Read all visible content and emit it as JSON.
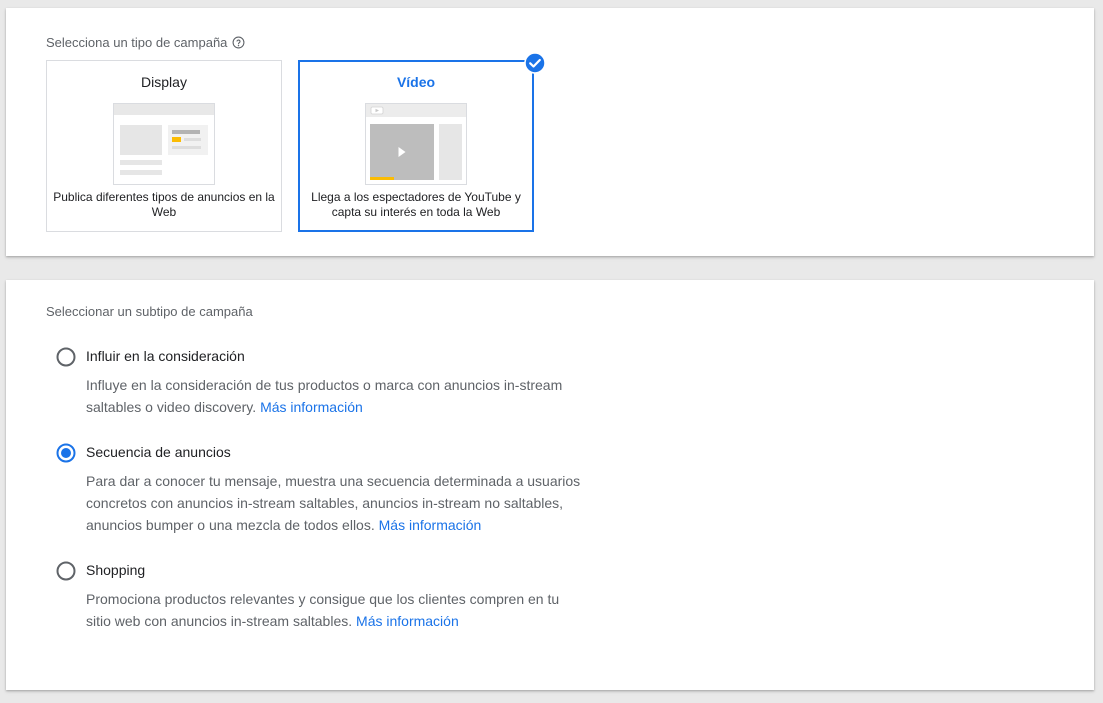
{
  "campaign_type": {
    "label": "Selecciona un tipo de campaña",
    "help_icon": "help-circle-icon",
    "options": [
      {
        "title": "Display",
        "description": "Publica diferentes tipos de anuncios en la Web",
        "selected": false,
        "illustration": "display-illustration-icon"
      },
      {
        "title": "Vídeo",
        "description": "Llega a los espectadores de YouTube y capta su interés en toda la Web",
        "selected": true,
        "illustration": "video-illustration-icon",
        "badge_icon": "check-circle-icon"
      }
    ]
  },
  "campaign_subtype": {
    "label": "Seleccionar un subtipo de campaña",
    "more_info_label": "Más información",
    "options": [
      {
        "label": "Influir en la consideración",
        "description": "Influye en la consideración de tus productos o marca con anuncios in-stream saltables o video discovery.",
        "selected": false
      },
      {
        "label": "Secuencia de anuncios",
        "description": "Para dar a conocer tu mensaje, muestra una secuencia determinada a usuarios concretos con anuncios in-stream saltables, anuncios in-stream no saltables, anuncios bumper o una mezcla de todos ellos.",
        "selected": true
      },
      {
        "label": "Shopping",
        "description": "Promociona productos relevantes y consigue que los clientes compren en tu sitio web con anuncios in-stream saltables.",
        "selected": false
      }
    ]
  },
  "colors": {
    "accent": "#1a73e8",
    "border": "#dadce0",
    "muted_text": "#5f6368",
    "highlight_yellow": "#fbbc04"
  }
}
